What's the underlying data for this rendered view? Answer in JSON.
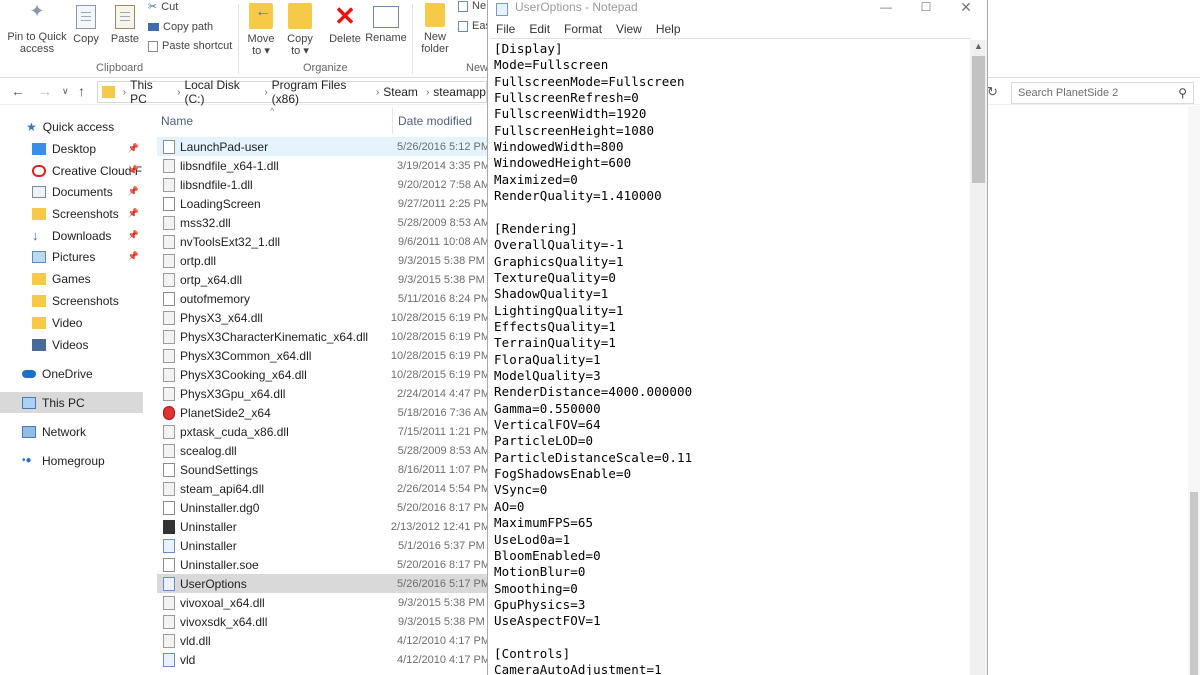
{
  "ribbon": {
    "pin": "Pin to Quick access",
    "copy": "Copy",
    "paste": "Paste",
    "cut": "Cut",
    "copy_path": "Copy path",
    "paste_shortcut": "Paste shortcut",
    "move_to": "Move to ▾",
    "copy_to": "Copy to ▾",
    "delete": "Delete",
    "rename": "Rename",
    "new_folder": "New folder",
    "new_item": "Ne",
    "easy_access": "Eas",
    "clipboard_group": "Clipboard",
    "organize_group": "Organize",
    "new_group": "New"
  },
  "address": {
    "segments": [
      "This PC",
      "Local Disk (C:)",
      "Program Files (x86)",
      "Steam",
      "steamapp"
    ],
    "search_placeholder": "Search PlanetSide 2"
  },
  "nav": {
    "quick_access": "Quick access",
    "items": [
      {
        "label": "Desktop",
        "pinned": true
      },
      {
        "label": "Creative Cloud F",
        "pinned": true
      },
      {
        "label": "Documents",
        "pinned": true
      },
      {
        "label": "Screenshots",
        "pinned": true
      },
      {
        "label": "Downloads",
        "pinned": true
      },
      {
        "label": "Pictures",
        "pinned": true
      },
      {
        "label": "Games",
        "pinned": false
      },
      {
        "label": "Screenshots",
        "pinned": false
      },
      {
        "label": "Video",
        "pinned": false
      },
      {
        "label": "Videos",
        "pinned": false
      }
    ],
    "onedrive": "OneDrive",
    "this_pc": "This PC",
    "network": "Network",
    "homegroup": "Homegroup"
  },
  "files": {
    "col_name": "Name",
    "col_date": "Date modified",
    "rows": [
      {
        "name": "LaunchPad-user",
        "date": "5/26/2016 5:12 PM",
        "icon": "doc"
      },
      {
        "name": "libsndfile_x64-1.dll",
        "date": "3/19/2014 3:35 PM",
        "icon": "dll"
      },
      {
        "name": "libsndfile-1.dll",
        "date": "9/20/2012 7:58 AM",
        "icon": "dll"
      },
      {
        "name": "LoadingScreen",
        "date": "9/27/2011 2:25 PM",
        "icon": "doc"
      },
      {
        "name": "mss32.dll",
        "date": "5/28/2009 8:53 AM",
        "icon": "dll"
      },
      {
        "name": "nvToolsExt32_1.dll",
        "date": "9/6/2011 10:08 AM",
        "icon": "dll"
      },
      {
        "name": "ortp.dll",
        "date": "9/3/2015 5:38 PM",
        "icon": "dll"
      },
      {
        "name": "ortp_x64.dll",
        "date": "9/3/2015 5:38 PM",
        "icon": "dll"
      },
      {
        "name": "outofmemory",
        "date": "5/11/2016 8:24 PM",
        "icon": "doc"
      },
      {
        "name": "PhysX3_x64.dll",
        "date": "10/28/2015 6:19 PM",
        "icon": "dll"
      },
      {
        "name": "PhysX3CharacterKinematic_x64.dll",
        "date": "10/28/2015 6:19 PM",
        "icon": "dll"
      },
      {
        "name": "PhysX3Common_x64.dll",
        "date": "10/28/2015 6:19 PM",
        "icon": "dll"
      },
      {
        "name": "PhysX3Cooking_x64.dll",
        "date": "10/28/2015 6:19 PM",
        "icon": "dll"
      },
      {
        "name": "PhysX3Gpu_x64.dll",
        "date": "2/24/2014 4:47 PM",
        "icon": "dll"
      },
      {
        "name": "PlanetSide2_x64",
        "date": "5/18/2016 7:36 AM",
        "icon": "red"
      },
      {
        "name": "pxtask_cuda_x86.dll",
        "date": "7/15/2011 1:21 PM",
        "icon": "dll"
      },
      {
        "name": "scealog.dll",
        "date": "5/28/2009 8:53 AM",
        "icon": "dll"
      },
      {
        "name": "SoundSettings",
        "date": "8/16/2011 1:07 PM",
        "icon": "doc"
      },
      {
        "name": "steam_api64.dll",
        "date": "2/26/2014 5:54 PM",
        "icon": "dll"
      },
      {
        "name": "Uninstaller.dg0",
        "date": "5/20/2016 8:17 PM",
        "icon": "doc"
      },
      {
        "name": "Uninstaller",
        "date": "2/13/2012 12:41 PM",
        "icon": "dark"
      },
      {
        "name": "Uninstaller",
        "date": "5/1/2016 5:37 PM",
        "icon": "exe"
      },
      {
        "name": "Uninstaller.soe",
        "date": "5/20/2016 8:17 PM",
        "icon": "doc"
      },
      {
        "name": "UserOptions",
        "date": "5/26/2016 5:17 PM",
        "icon": "exe"
      },
      {
        "name": "vivoxoal_x64.dll",
        "date": "9/3/2015 5:38 PM",
        "icon": "dll"
      },
      {
        "name": "vivoxsdk_x64.dll",
        "date": "9/3/2015 5:38 PM",
        "icon": "dll"
      },
      {
        "name": "vld.dll",
        "date": "4/12/2010 4:17 PM",
        "icon": "dll"
      },
      {
        "name": "vld",
        "date": "4/12/2010 4:17 PM",
        "icon": "exe"
      }
    ]
  },
  "notepad": {
    "title": "UserOptions - Notepad",
    "menu": [
      "File",
      "Edit",
      "Format",
      "View",
      "Help"
    ],
    "lines": [
      "[Display]",
      "Mode=Fullscreen",
      "FullscreenMode=Fullscreen",
      "FullscreenRefresh=0",
      "FullscreenWidth=1920",
      "FullscreenHeight=1080",
      "WindowedWidth=800",
      "WindowedHeight=600",
      "Maximized=0",
      "RenderQuality=1.410000",
      "",
      "[Rendering]",
      "OverallQuality=-1",
      "GraphicsQuality=1",
      "TextureQuality=0",
      "ShadowQuality=1",
      "LightingQuality=1",
      "EffectsQuality=1",
      "TerrainQuality=1",
      "FloraQuality=1",
      "ModelQuality=3",
      "RenderDistance=4000.000000",
      "Gamma=0.550000",
      "VerticalFOV=64",
      "ParticleLOD=0",
      "ParticleDistanceScale=0.11",
      "FogShadowsEnable=0",
      "VSync=0",
      "AO=0",
      "MaximumFPS=65",
      "UseLod0a=1",
      "BloomEnabled=0",
      "MotionBlur=0",
      "Smoothing=0",
      "GpuPhysics=3",
      "UseAspectFOV=1",
      "",
      "[Controls]",
      "CameraAutoAdjustment=1"
    ]
  }
}
